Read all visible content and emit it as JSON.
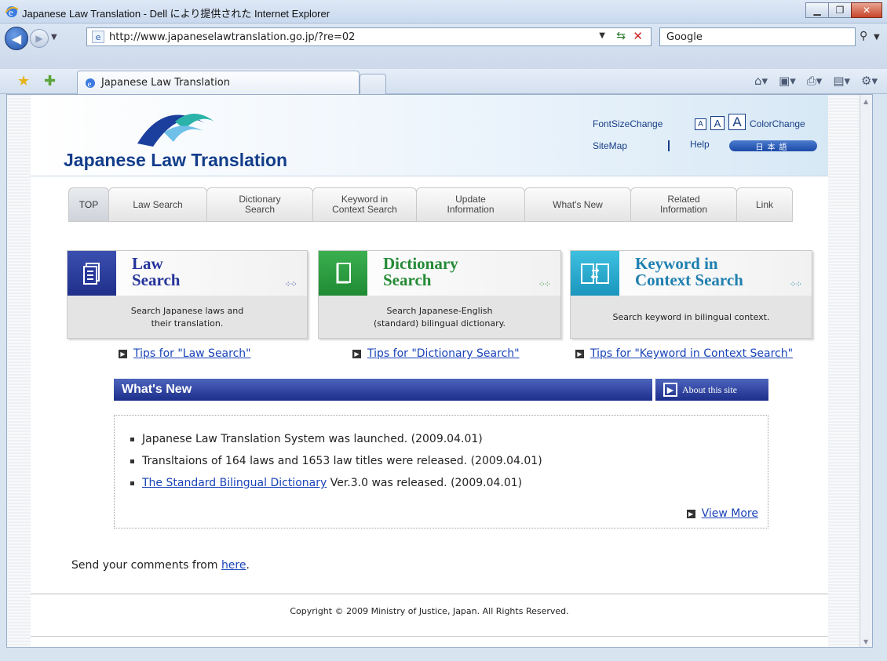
{
  "window": {
    "title": "Japanese Law Translation - Dell により提供された Internet Explorer"
  },
  "address": {
    "url": "http://www.japaneselawtranslation.go.jp/?re=02",
    "search_placeholder": "Google"
  },
  "tab": {
    "label": "Japanese Law Translation"
  },
  "header": {
    "logo_text": "Japanese Law Translation",
    "font_size_change": "FontSizeChange",
    "font_sizes": [
      "A",
      "A",
      "A"
    ],
    "color_change": "ColorChange",
    "sitemap": "SiteMap",
    "help": "Help",
    "japanese": "日本語"
  },
  "nav": [
    {
      "label": "TOP"
    },
    {
      "label": "Law Search"
    },
    {
      "label": "Dictionary\nSearch"
    },
    {
      "label": "Keyword in\nContext Search"
    },
    {
      "label": "Update\nInformation"
    },
    {
      "label": "What's New"
    },
    {
      "label": "Related\nInformation"
    },
    {
      "label": "Link"
    }
  ],
  "cards": [
    {
      "title": "Law\nSearch",
      "desc": "Search Japanese laws and\ntheir translation.",
      "color": "#2b3d9e"
    },
    {
      "title": "Dictionary\nSearch",
      "desc": "Search Japanese-English\n(standard) bilingual dictionary.",
      "color": "#2e9a3e"
    },
    {
      "title": "Keyword in\nContext Search",
      "desc": "Search keyword in bilingual context.",
      "color": "#1fa0c4"
    }
  ],
  "tips": [
    "Tips for \"Law Search\"",
    "Tips for \"Dictionary Search\"",
    "Tips for \"Keyword in Context Search\""
  ],
  "whats_new": {
    "title": "What's New",
    "about": "About this site",
    "items": [
      {
        "text": "Japanese Law Translation System was launched. (2009.04.01)"
      },
      {
        "text": "Transltaions of 164 laws and 1653 law titles were released. (2009.04.01)"
      },
      {
        "link": "The Standard Bilingual Dictionary",
        "text": " Ver.3.0 was released. (2009.04.01)"
      }
    ],
    "view_more": "View More"
  },
  "comments": {
    "prefix": "Send your comments from ",
    "link": "here",
    "suffix": "."
  },
  "footer": {
    "copyright": "Copyright © 2009 Ministry of Justice, Japan. All Rights Reserved."
  }
}
